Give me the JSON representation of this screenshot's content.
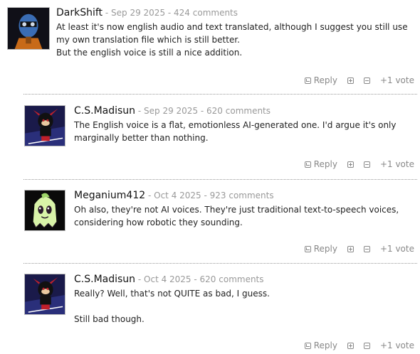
{
  "actions": {
    "reply": "Reply",
    "vote": "+1 vote"
  },
  "comments": [
    {
      "author": "DarkShift",
      "meta": "- Sep 29 2025 - 424 comments",
      "lines": [
        "At least it's now english audio and text translated, although I suggest you still use my own translation file which is still better.",
        "But the english voice is still a nice addition."
      ]
    },
    {
      "author": "C.S.Madisun",
      "meta": "- Sep 29 2025 - 620 comments",
      "lines": [
        "The English voice is a flat, emotionless AI-generated one. I'd argue it's only marginally better than nothing."
      ]
    },
    {
      "author": "Meganium412",
      "meta": "- Oct 4 2025 - 923 comments",
      "lines": [
        "Oh also, they're not AI voices. They're just traditional text-to-speech voices, considering how robotic they sounding."
      ]
    },
    {
      "author": "C.S.Madisun",
      "meta": "- Oct 4 2025 - 620 comments",
      "lines": [
        "Really? Well, that's not QUITE as bad, I guess.",
        "",
        "Still bad though."
      ]
    }
  ]
}
